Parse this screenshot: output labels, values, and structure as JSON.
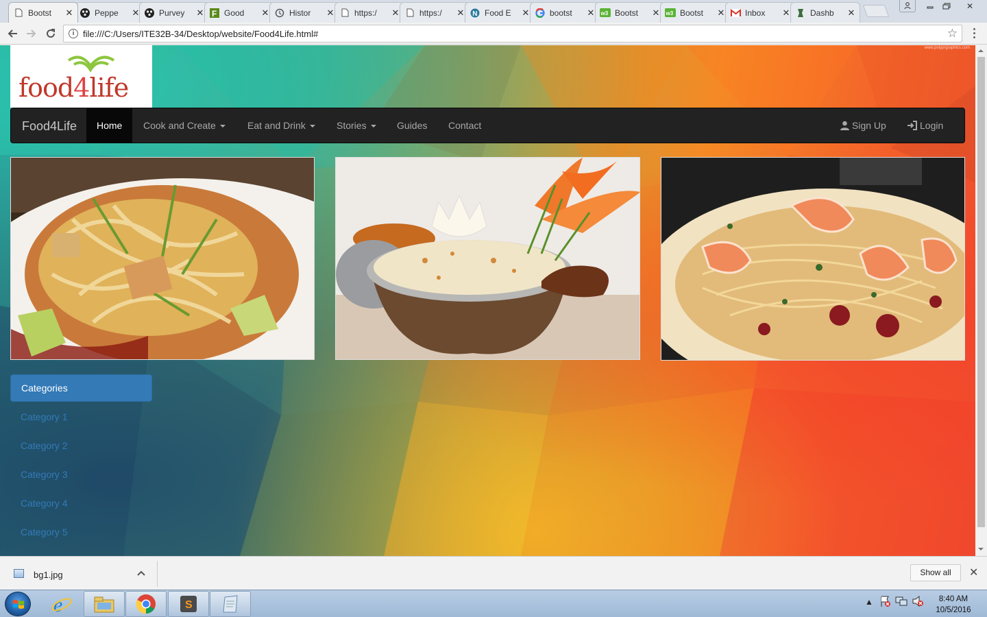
{
  "browser": {
    "tabs": [
      {
        "title": "Bootst",
        "icon": "page-icon",
        "active": true
      },
      {
        "title": "Peppe",
        "icon": "site-dots-icon"
      },
      {
        "title": "Purvey",
        "icon": "site-dots-icon"
      },
      {
        "title": "Good",
        "icon": "site-f-icon"
      },
      {
        "title": "Histor",
        "icon": "history-icon"
      },
      {
        "title": "https:/",
        "icon": "page-icon"
      },
      {
        "title": "https:/",
        "icon": "page-icon"
      },
      {
        "title": "Food E",
        "icon": "site-n-icon"
      },
      {
        "title": "bootst",
        "icon": "google-icon"
      },
      {
        "title": "Bootst",
        "icon": "site-w3-icon"
      },
      {
        "title": "Bootst",
        "icon": "site-w3-icon"
      },
      {
        "title": "Inbox",
        "icon": "gmail-icon"
      },
      {
        "title": "Dashb",
        "icon": "site-dash-icon"
      }
    ],
    "address": "file:///C:/Users/ITE32B-34/Desktop/website/Food4Life.html#"
  },
  "page": {
    "watermark": "www.polyprgraphics.com",
    "logo": {
      "text_left": "food",
      "text_mid": "4",
      "text_right": "life"
    },
    "navbar": {
      "brand": "Food4Life",
      "items": [
        {
          "label": "Home",
          "active": true,
          "dropdown": false
        },
        {
          "label": "Cook and Create",
          "dropdown": true
        },
        {
          "label": "Eat and Drink",
          "dropdown": true
        },
        {
          "label": "Stories",
          "dropdown": true
        },
        {
          "label": "Guides",
          "dropdown": false
        },
        {
          "label": "Contact",
          "dropdown": false
        }
      ],
      "right": [
        {
          "label": "Sign Up",
          "icon": "user-icon"
        },
        {
          "label": "Login",
          "icon": "login-icon"
        }
      ]
    },
    "photos": [
      {
        "name": "stir-fried-noodles-photo"
      },
      {
        "name": "biryani-photo"
      },
      {
        "name": "shrimp-pad-thai-photo"
      }
    ],
    "sidebar": {
      "heading": "Categories",
      "items": [
        "Category 1",
        "Category 2",
        "Category 3",
        "Category 4",
        "Category 5"
      ]
    }
  },
  "downloads": {
    "file": "bg1.jpg",
    "show_all": "Show all"
  },
  "taskbar": {
    "time": "8:40 AM",
    "date": "10/5/2016"
  },
  "colors": {
    "navbar": "#222222",
    "accent": "#337ab7",
    "logo_red": "#c0392b",
    "logo_green": "#8dc63f"
  }
}
